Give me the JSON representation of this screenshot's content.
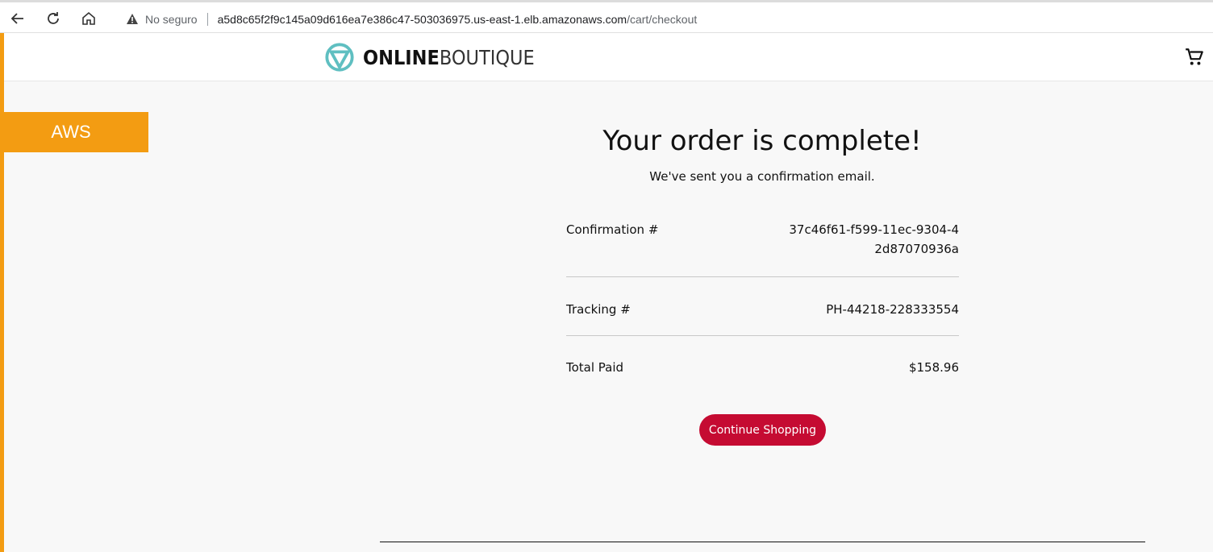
{
  "browser": {
    "insecure_label": "No seguro",
    "url_host": "a5d8c65f2f9c145a09d616ea7e386c47-503036975.us-east-1.elb.amazonaws.com",
    "url_path": "/cart/checkout"
  },
  "header": {
    "logo_bold": "ONLINE",
    "logo_light": "BOUTIQUE",
    "cart_icon": "cart-icon"
  },
  "badge": {
    "label": "AWS"
  },
  "order": {
    "title": "Your order is complete!",
    "subtitle": "We've sent you a confirmation email.",
    "rows": [
      {
        "label": "Confirmation #",
        "value": "37c46f61-f599-11ec-9304-42d87070936a"
      },
      {
        "label": "Tracking #",
        "value": "PH-44218-228333554"
      },
      {
        "label": "Total Paid",
        "value": "$158.96"
      }
    ],
    "continue_label": "Continue Shopping"
  },
  "colors": {
    "accent_orange": "#f39c12",
    "button_red": "#c50b32",
    "logo_teal": "#5fbfc1"
  }
}
